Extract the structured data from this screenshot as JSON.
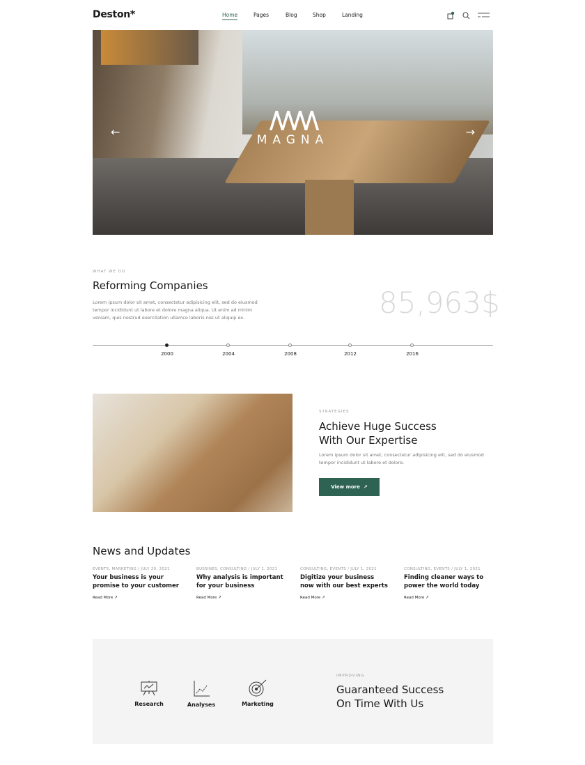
{
  "header": {
    "logo": "Deston*",
    "nav": [
      {
        "label": "Home",
        "active": true
      },
      {
        "label": "Pages"
      },
      {
        "label": "Blog"
      },
      {
        "label": "Shop"
      },
      {
        "label": "Landing"
      }
    ],
    "icons": [
      "cart-icon",
      "search-icon",
      "menu-icon"
    ],
    "accent": "#2e6353"
  },
  "hero": {
    "brand": "MAGNA",
    "prev": "←",
    "next": "→"
  },
  "about": {
    "eyebrow": "WHAT WE DO",
    "title": "Reforming Companies",
    "text": "Lorem ipsum dolor sit amet, consectetur adipisicing elit, sed do eiusmod tempor incididunt ut labore et dolore magna aliqua. Ut enim ad minim veniam, quis nostrud exercitation ullamco laboris nisi ut aliquip ex.",
    "stat": "85,963$",
    "timeline": [
      {
        "year": "2000",
        "active": true
      },
      {
        "year": "2004"
      },
      {
        "year": "2008"
      },
      {
        "year": "2012"
      },
      {
        "year": "2016"
      }
    ]
  },
  "strategy": {
    "eyebrow": "STRATEGIES",
    "title1": "Achieve Huge Success",
    "title2": "With Our Expertise",
    "text": "Lorem ipsum dolor sit amet, consectetur adipisicing elit, sed do eiusmod tempor incididunt ut labore et dolore.",
    "button": "View more",
    "button_icon": "↗"
  },
  "news": {
    "title": "News and Updates",
    "read_more": "Read More",
    "items": [
      {
        "meta": "EVENTS, MARKETING / JULY 20, 2021",
        "title": "Your business is your promise to your customer"
      },
      {
        "meta": "BUSSINES, CONSULTING / JULY 1, 2021",
        "title": "Why analysis is important for your business"
      },
      {
        "meta": "CONSULTING, EVENTS / JULY 1, 2021",
        "title": "Digitize your business now with our best experts"
      },
      {
        "meta": "CONSULTING, EVENTS / JULY 1, 2021",
        "title": "Finding cleaner ways to power the world today"
      }
    ]
  },
  "features": {
    "items": [
      {
        "label": "Research",
        "icon": "presentation-chart-icon"
      },
      {
        "label": "Analyses",
        "icon": "line-chart-icon"
      },
      {
        "label": "Marketing",
        "icon": "target-icon"
      }
    ],
    "eyebrow": "IMPROVING",
    "title1": "Guaranteed Success",
    "title2": "On Time With Us"
  }
}
